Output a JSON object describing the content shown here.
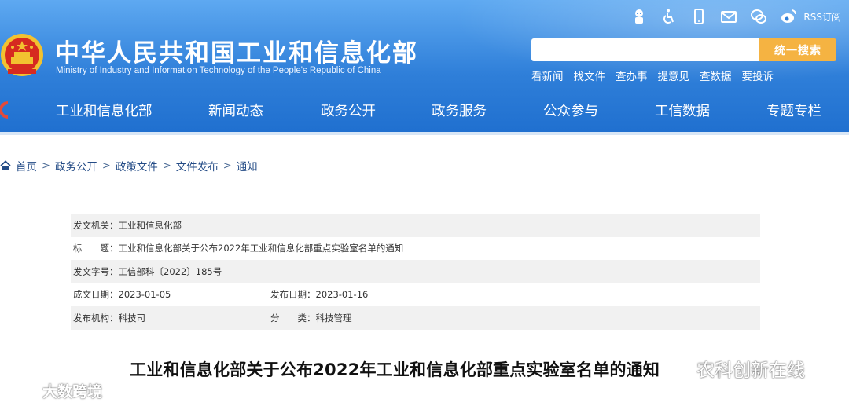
{
  "header": {
    "site_title": "中华人民共和国工业和信息化部",
    "site_subtitle": "Ministry of Industry and Information Technology of the People's Republic of China",
    "top_icons": [
      "robot-icon",
      "accessibility-icon",
      "mobile-icon",
      "mail-icon",
      "wechat-icon",
      "weibo-icon"
    ],
    "rss_label": "RSS订阅",
    "search": {
      "placeholder": "",
      "button_label": "统一搜索"
    },
    "quick_links": [
      "看新闻",
      "找文件",
      "查办事",
      "提意见",
      "查数据",
      "要投诉"
    ],
    "colors": {
      "header_blue": "#2f7fd9",
      "search_button": "#f5b342"
    }
  },
  "nav": {
    "items": [
      "工业和信息化部",
      "新闻动态",
      "政务公开",
      "政务服务",
      "公众参与",
      "工信数据",
      "专题专栏"
    ]
  },
  "breadcrumb": [
    "首页",
    "政务公开",
    "政策文件",
    "文件发布",
    "通知"
  ],
  "info": {
    "issuer_label": "发文机关：",
    "issuer": "工业和信息化部",
    "title_label": "标　　题：",
    "title": "工业和信息化部关于公布2022年工业和信息化部重点实验室名单的通知",
    "doc_no_label": "发文字号：",
    "doc_no": "工信部科〔2022〕185号",
    "written_label": "成文日期：",
    "written": "2023-01-05",
    "published_label": "发布日期：",
    "published": "2023-01-16",
    "org_label": "发布机构：",
    "org": "科技司",
    "category_label": "分　　类：",
    "category": "科技管理"
  },
  "headline": "工业和信息化部关于公布2022年工业和信息化部重点实验室名单的通知",
  "watermarks": {
    "left": "大数跨境",
    "right": "农科创新在线"
  }
}
